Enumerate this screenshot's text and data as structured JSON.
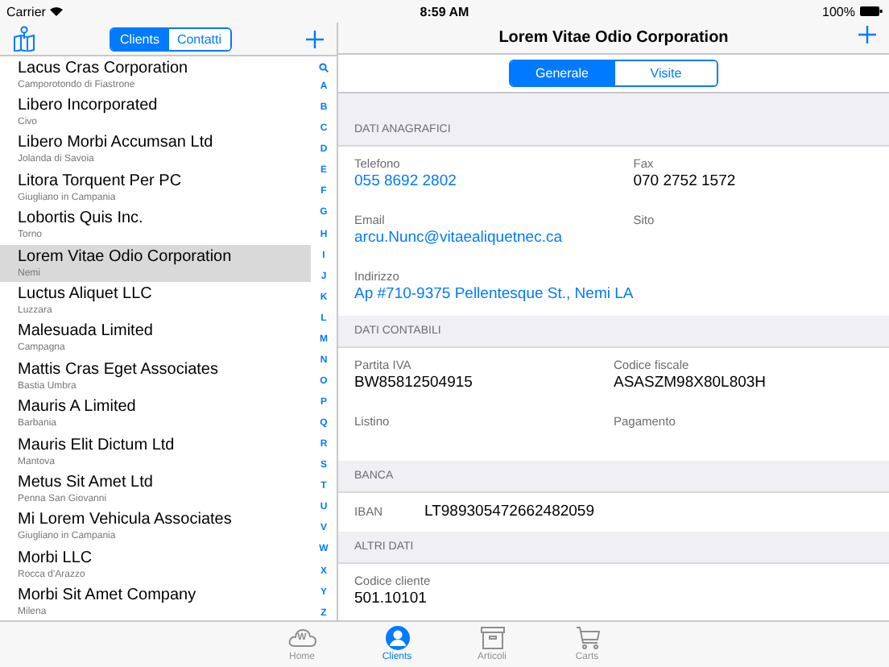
{
  "status_bar": {
    "carrier": "Carrier",
    "time": "8:59 AM",
    "battery": "100%"
  },
  "sidebar": {
    "segments": [
      {
        "label": "Clients",
        "selected": true
      },
      {
        "label": "Contatti",
        "selected": false
      }
    ],
    "clients": [
      {
        "name": "Lacus Cras Corporation",
        "city": "Camporotondo di Fiastrone",
        "selected": false
      },
      {
        "name": "Libero Incorporated",
        "city": "Civo",
        "selected": false
      },
      {
        "name": "Libero Morbi Accumsan Ltd",
        "city": "Jolanda di Savoia",
        "selected": false
      },
      {
        "name": "Litora Torquent Per PC",
        "city": "Giugliano in Campania",
        "selected": false
      },
      {
        "name": "Lobortis Quis Inc.",
        "city": "Torno",
        "selected": false
      },
      {
        "name": "Lorem Vitae Odio Corporation",
        "city": "Nemi",
        "selected": true
      },
      {
        "name": "Luctus Aliquet LLC",
        "city": "Luzzara",
        "selected": false
      },
      {
        "name": "Malesuada Limited",
        "city": "Campagna",
        "selected": false
      },
      {
        "name": "Mattis Cras Eget Associates",
        "city": "Bastia Umbra",
        "selected": false
      },
      {
        "name": "Mauris A Limited",
        "city": "Barbania",
        "selected": false
      },
      {
        "name": "Mauris Elit Dictum Ltd",
        "city": "Mantova",
        "selected": false
      },
      {
        "name": "Metus Sit Amet Ltd",
        "city": "Penna San Giovanni",
        "selected": false
      },
      {
        "name": "Mi Lorem Vehicula Associates",
        "city": "Giugliano in Campania",
        "selected": false
      },
      {
        "name": "Morbi LLC",
        "city": "Rocca d'Arazzo",
        "selected": false
      },
      {
        "name": "Morbi Sit Amet Company",
        "city": "Milena",
        "selected": false
      }
    ],
    "index": [
      "A",
      "B",
      "C",
      "D",
      "E",
      "F",
      "G",
      "H",
      "I",
      "J",
      "K",
      "L",
      "M",
      "N",
      "O",
      "P",
      "Q",
      "R",
      "S",
      "T",
      "U",
      "V",
      "W",
      "X",
      "Y",
      "Z"
    ]
  },
  "detail": {
    "title": "Lorem Vitae Odio Corporation",
    "segments": [
      {
        "label": "Generale",
        "selected": true
      },
      {
        "label": "Visite",
        "selected": false
      }
    ],
    "sections": [
      {
        "title": "DATI ANAGRAFICI",
        "kind": "grid",
        "fields": [
          {
            "label": "Telefono",
            "value": "055 8692 2802",
            "link": true
          },
          {
            "label": "Fax",
            "value": "070 2752 1572",
            "link": false
          },
          {
            "label": "Email",
            "value": "arcu.Nunc@vitaealiquetnec.ca",
            "link": true
          },
          {
            "label": "Sito"
          },
          {
            "label": "Indirizzo",
            "value": "Ap #710-9375 Pellentesque St., Nemi LA",
            "link": true
          }
        ]
      },
      {
        "title": "DATI CONTABILI",
        "kind": "grid",
        "fields": [
          {
            "label": "Partita IVA",
            "value": "BW85812504915",
            "link": false
          },
          {
            "label": "Codice fiscale",
            "value": "ASASZM98X80L803H",
            "link": false
          },
          {
            "label": "Listino"
          },
          {
            "label": "Pagamento"
          }
        ]
      },
      {
        "title": "BANCA",
        "kind": "inline",
        "fields": [
          {
            "label": "IBAN",
            "value": "LT989305472662482059",
            "link": false
          }
        ]
      },
      {
        "title": "ALTRI DATI",
        "kind": "grid",
        "fields": [
          {
            "label": "Codice cliente",
            "value": "501.10101",
            "link": false
          }
        ]
      }
    ]
  },
  "tab_bar": [
    {
      "label": "Home",
      "badge": "W",
      "selected": false
    },
    {
      "label": "Clients",
      "selected": true
    },
    {
      "label": "Articoli",
      "selected": false
    },
    {
      "label": "Carts",
      "selected": false
    }
  ]
}
